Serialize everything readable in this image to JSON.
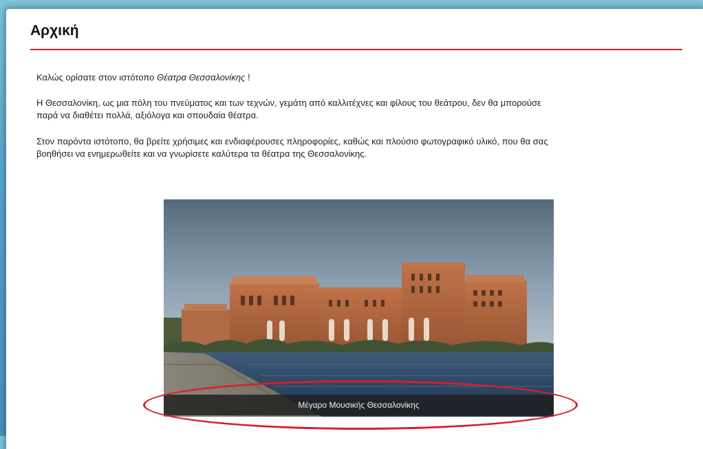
{
  "page": {
    "title": "Αρχική",
    "accent_color": "#c62828"
  },
  "intro": {
    "prefix": "Καλώς ορίσατε στον ιστότοπο ",
    "site_name": "Θέατρα Θεσσαλονίκης",
    "suffix": " !"
  },
  "paragraph2": {
    "line1": "Η Θεσσαλονίκη, ως μια πόλη του πνεύματος και των τεχνών, γεμάτη από καλλιτέχνες και φίλους του θεάτρου, δεν θα μπορούσε",
    "line2": "παρά να διαθέτει πολλά, αξιόλογα και σπουδαία θέατρα."
  },
  "paragraph3": {
    "line1": "Στον παρόντα ιστότοπο, θα βρείτε χρήσιμες και ενδιαφέρουσες πληροφορίες, καθώς και πλούσιο φωτογραφικό υλικό, που θα σας",
    "line2": "βοηθήσει να ενημερωθείτε και να γνωρίσετε καλύτερα τα θέατρα της Θεσσαλονίκης."
  },
  "slideshow": {
    "caption": "Μέγαρο Μουσικής Θεσσαλονίκης",
    "annotation_color": "#d81e2a"
  }
}
